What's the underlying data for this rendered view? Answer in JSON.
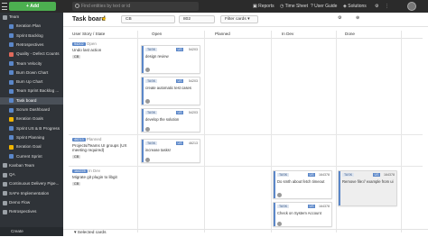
{
  "topbar": {
    "add_label": "Add",
    "search_placeholder": "Find entities by text or id",
    "reports": "Reports",
    "timesheet": "Time Sheet",
    "user_guide": "User Guide",
    "solutions": "Solutions"
  },
  "sidebar": {
    "items": [
      {
        "label": "Team",
        "color": "#9aa0a6",
        "top": true
      },
      {
        "label": "Iteration Plan",
        "color": "#5b87c9"
      },
      {
        "label": "Sprint Backlog",
        "color": "#5b87c9"
      },
      {
        "label": "Retrospectives",
        "color": "#5b87c9"
      },
      {
        "label": "Quality - Defect Counts",
        "color": "#e06a5b"
      },
      {
        "label": "Team Velocity",
        "color": "#5b87c9"
      },
      {
        "label": "Burn Down Chart",
        "color": "#5b87c9"
      },
      {
        "label": "Burn Up Chart",
        "color": "#5b87c9"
      },
      {
        "label": "Team Sprint Backlog ...",
        "color": "#5b87c9"
      },
      {
        "label": "Task board",
        "color": "#5b87c9",
        "active": true
      },
      {
        "label": "Scrum Dashboard",
        "color": "#5b87c9"
      },
      {
        "label": "Iteration Goals",
        "color": "#f0b400"
      },
      {
        "label": "Sprint US & B Progress",
        "color": "#5b87c9"
      },
      {
        "label": "Sprint Planning",
        "color": "#5b87c9"
      },
      {
        "label": "Iteration Goal",
        "color": "#f0b400"
      },
      {
        "label": "Current Sprint",
        "color": "#5b87c9"
      },
      {
        "label": "Kanban Team",
        "color": "#9aa0a6",
        "top": true
      },
      {
        "label": "QA",
        "color": "#9aa0a6",
        "top": true
      },
      {
        "label": "Continuous Delivery Pipe...",
        "color": "#9aa0a6",
        "top": true
      },
      {
        "label": "SAFe Implementation",
        "color": "#9aa0a6",
        "top": true
      },
      {
        "label": "Demo Flow",
        "color": "#9aa0a6",
        "top": true
      },
      {
        "label": "Retrospectives",
        "color": "#9aa0a6",
        "top": true
      }
    ],
    "create_label": "Create"
  },
  "header": {
    "title": "Task board",
    "cb_chip": "CB",
    "count_chip": "802",
    "filter_label": "Filter cards"
  },
  "columns": {
    "story": "User Story / State",
    "open": "Open",
    "planned": "Planned",
    "in_dev": "In Dev",
    "done": "Done"
  },
  "rows": [
    {
      "id": "94202",
      "state": "Open",
      "name": "Undo last action",
      "avatar": "CB"
    },
    {
      "id": "46213",
      "state": "Planned",
      "name": "Projects/Teams UI groups (UX meeting required)",
      "avatar": "CB"
    },
    {
      "id": "164378",
      "state": "In Dev",
      "name": "Migrate git plugin to libgit",
      "avatar": "CB"
    }
  ],
  "cards": {
    "c1": {
      "type": "TASK",
      "us": "US",
      "id": "54203",
      "name": "design review"
    },
    "c2": {
      "type": "TASK",
      "us": "US",
      "id": "54203",
      "name": "create automatic test cases"
    },
    "c3": {
      "type": "TASK",
      "us": "US",
      "id": "54203",
      "name": "develop the solution"
    },
    "c4": {
      "type": "TASK",
      "us": "US",
      "id": "46213",
      "name": "increase tasks!"
    },
    "c5": {
      "type": "TASK",
      "us": "US",
      "id": "164378",
      "name": "Do smth about fetch timeout"
    },
    "c6": {
      "type": "TASK",
      "us": "US",
      "id": "164378",
      "name": "Check on System Account"
    },
    "c7": {
      "type": "TASK",
      "us": "US",
      "id": "164378",
      "name": "Remove file:// example from ui"
    }
  },
  "footer": {
    "selected_label": "Selected cards"
  }
}
